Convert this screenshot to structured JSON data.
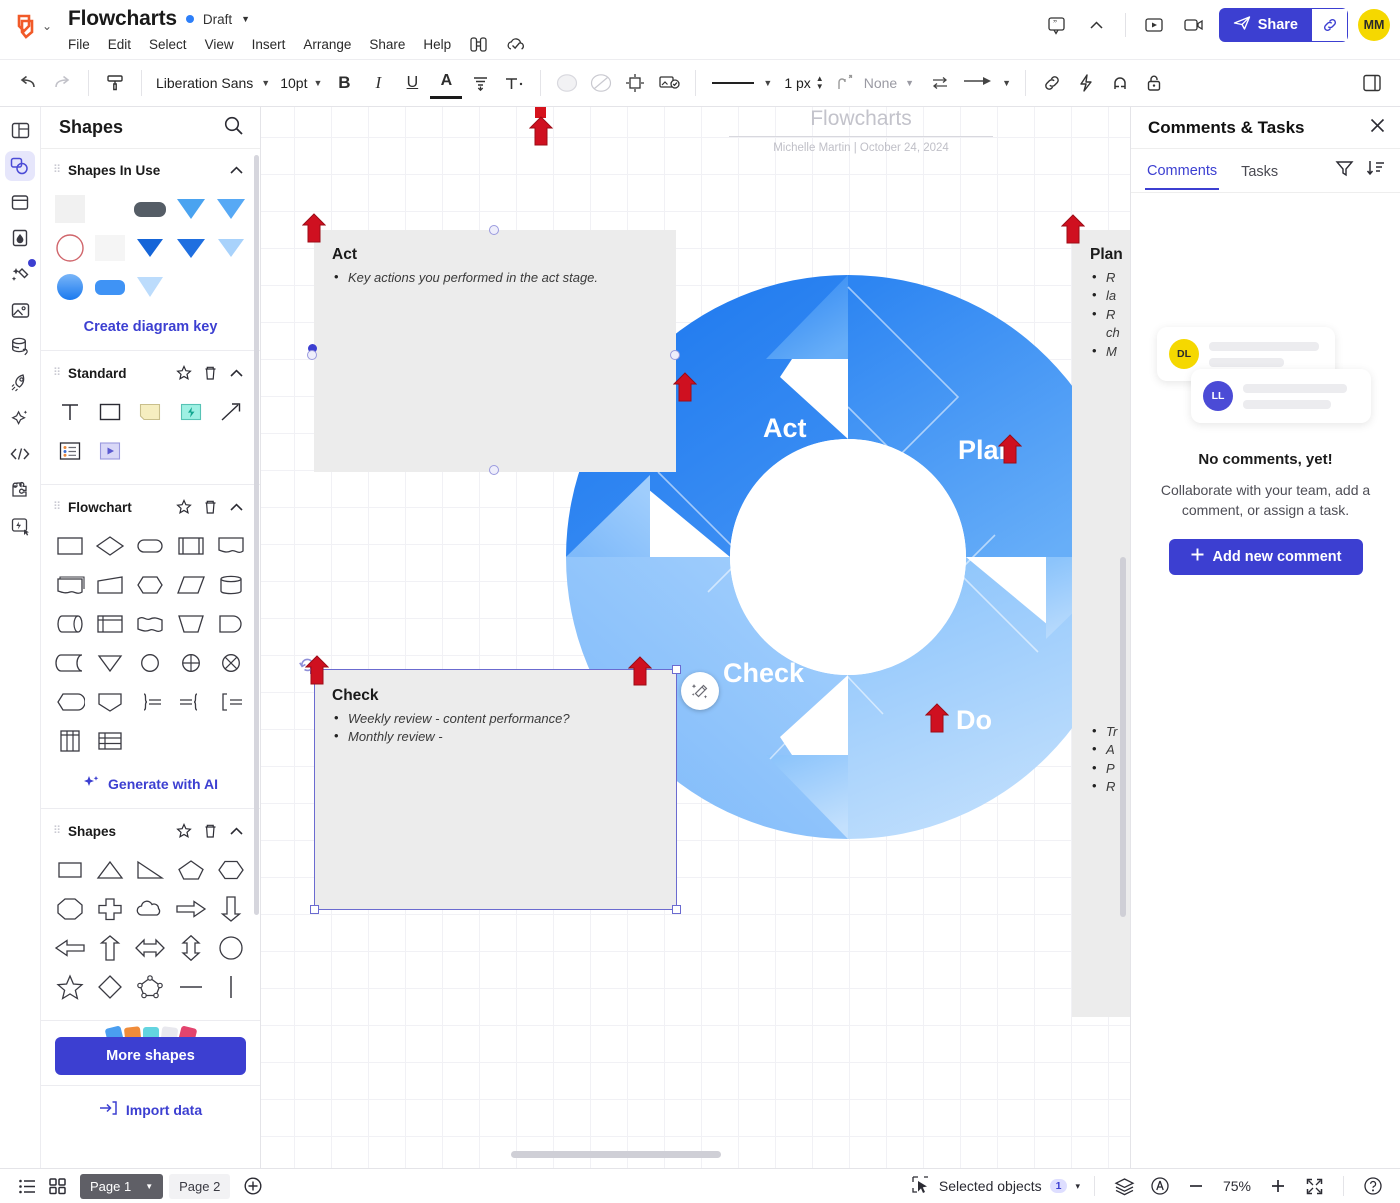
{
  "app": {
    "logo_name": "lucid-logo",
    "doc_title": "Flowcharts",
    "status_label": "Draft",
    "menu": [
      "File",
      "Edit",
      "Select",
      "View",
      "Insert",
      "Arrange",
      "Share",
      "Help"
    ],
    "menu_icons": [
      "binoculars-icon",
      "cloud-check-icon"
    ],
    "accent": "#3c3fd1",
    "avatar_initials": "MM",
    "avatar_color": "#f5d800",
    "share_label": "Share",
    "top_right_icons": [
      "comment-icon",
      "collapse-chevron-icon",
      "present-icon",
      "record-video-icon"
    ]
  },
  "format_toolbar": {
    "undo": "undo-icon",
    "redo": "redo-icon",
    "paint_format": "format-painter-icon",
    "font_family": "Liberation Sans",
    "font_size": "10pt",
    "bold": "B",
    "italic": "I",
    "underline": "U",
    "font_color": "A",
    "align": "text-align-icon",
    "text_options": "T",
    "fill_icon": "fill-color-icon",
    "no_fill_icon": "no-fill-icon",
    "border_icon": "border-icon",
    "image_fill_icon": "image-fill-icon",
    "line_style": "solid-line",
    "line_weight": "1 px",
    "line_jump": "line-jump-icon",
    "arrow_start": "None",
    "swap_icon": "swap-ends-icon",
    "arrow_end": "arrow-end-icon",
    "link_icon": "link-icon",
    "action_icon": "lightning-icon",
    "magnet_icon": "magnet-icon",
    "lock_icon": "lock-icon",
    "panel_toggle_icon": "right-panel-icon"
  },
  "rail": [
    {
      "name": "layout-templates-icon",
      "active": false
    },
    {
      "name": "shapes-icon",
      "active": true
    },
    {
      "name": "containers-icon",
      "active": false
    },
    {
      "name": "themes-icon",
      "active": false
    },
    {
      "name": "ai-magic-icon",
      "active": false,
      "badge": true
    },
    {
      "name": "images-icon",
      "active": false
    },
    {
      "name": "data-icon",
      "active": false
    },
    {
      "name": "rocket-icon",
      "active": false
    },
    {
      "name": "sparkle-icon",
      "active": false
    },
    {
      "name": "code-icon",
      "active": false
    },
    {
      "name": "integrations-icon",
      "active": false
    },
    {
      "name": "actions-icon",
      "active": false
    }
  ],
  "shapes_panel": {
    "title": "Shapes",
    "search_icon": "search-icon",
    "sections": [
      {
        "name": "Shapes In Use",
        "create_key_label": "Create diagram key",
        "swatches": [
          {
            "kind": "square",
            "color": "#f1f1f1"
          },
          {
            "kind": "empty",
            "color": "transparent"
          },
          {
            "kind": "rounded",
            "color": "#555d66"
          },
          {
            "kind": "triangle-down",
            "color": "#4aa3f0"
          },
          {
            "kind": "triangle-down",
            "color": "#57a9f5"
          },
          {
            "kind": "circle-outline",
            "color": "#d0656b"
          },
          {
            "kind": "square",
            "color": "#f5f5f5"
          },
          {
            "kind": "triangle-down",
            "color": "#1565d8"
          },
          {
            "kind": "triangle-down",
            "color": "#1f6fe0"
          },
          {
            "kind": "triangle-down",
            "color": "#a8d2fb"
          },
          {
            "kind": "circle-grad",
            "color": "#3f93f5"
          },
          {
            "kind": "rounded",
            "color": "#3f93f5"
          },
          {
            "kind": "triangle-down",
            "color": "#bcdcfc"
          }
        ]
      },
      {
        "name": "Standard",
        "icons": [
          "text-shape",
          "rectangle-shape",
          "sticky-note-shape",
          "action-shape",
          "line-arrow-shape",
          "list-shape",
          "play-shape"
        ]
      },
      {
        "name": "Flowchart",
        "ai_label": "Generate with AI",
        "count": 27
      },
      {
        "name": "Shapes",
        "count": 20
      }
    ],
    "more_shapes_label": "More shapes",
    "import_data_label": "Import data"
  },
  "canvas": {
    "page_title": "Flowcharts",
    "page_author": "Michelle Martin",
    "page_date": "October 24, 2024",
    "separator": "|",
    "magic_bubble_icon": "magic-wand-icon",
    "wheel": {
      "segments": [
        {
          "label": "Plan",
          "color_from": "#2f86f2",
          "color_to": "#4f9df6"
        },
        {
          "label": "Do",
          "color_from": "#8cc4fb",
          "color_to": "#bcdcfd"
        },
        {
          "label": "Check",
          "color_from": "#9fcdfc",
          "color_to": "#7bb8fa"
        },
        {
          "label": "Act",
          "color_from": "#1f79ef",
          "color_to": "#3d8ff4"
        }
      ]
    },
    "boxes": [
      {
        "id": "act",
        "title": "Act",
        "bullets": [
          "Key actions you performed in the act stage."
        ],
        "selected": false
      },
      {
        "id": "check",
        "title": "Check",
        "bullets": [
          "Weekly review - content performance?",
          "Monthly review -"
        ],
        "selected": true
      },
      {
        "id": "plan",
        "title": "Plan",
        "bullets": [
          "R",
          "la",
          "R",
          "ch",
          "M"
        ],
        "selected": false
      },
      {
        "id": "do",
        "title": "",
        "bullets": [
          "Tr",
          "A",
          "P",
          "R"
        ],
        "selected": false
      }
    ]
  },
  "comments_panel": {
    "title": "Comments & Tasks",
    "close_icon": "close-icon",
    "tabs": [
      {
        "label": "Comments",
        "active": true
      },
      {
        "label": "Tasks",
        "active": false
      }
    ],
    "filter_icon": "filter-icon",
    "sort_icon": "sort-icon",
    "ghost_avatars": [
      {
        "initials": "DL",
        "color": "#f5d800",
        "text": "#2a2a2a"
      },
      {
        "initials": "LL",
        "color": "#4b4bd6",
        "text": "#ffffff"
      }
    ],
    "empty_title": "No comments, yet!",
    "empty_subtitle": "Collaborate with your team, add a comment, or assign a task.",
    "add_button_label": "Add new comment",
    "add_button_icon": "plus-icon"
  },
  "status_bar": {
    "outline_icon": "outline-list-icon",
    "grid_icon": "page-grid-icon",
    "pages": [
      {
        "label": "Page 1",
        "active": true,
        "caret": true
      },
      {
        "label": "Page 2",
        "active": false,
        "caret": false
      }
    ],
    "add_page_icon": "add-page-icon",
    "selected_icon": "selection-cursor-icon",
    "selected_label": "Selected objects",
    "selected_count": "1",
    "selected_caret": "▾",
    "layers_icon": "layers-icon",
    "accessibility_icon": "accessibility-icon",
    "zoom_out_icon": "minus-icon",
    "zoom_level": "75%",
    "zoom_in_icon": "plus-icon",
    "fit_icon": "fit-screen-icon",
    "help_icon": "help-icon"
  }
}
